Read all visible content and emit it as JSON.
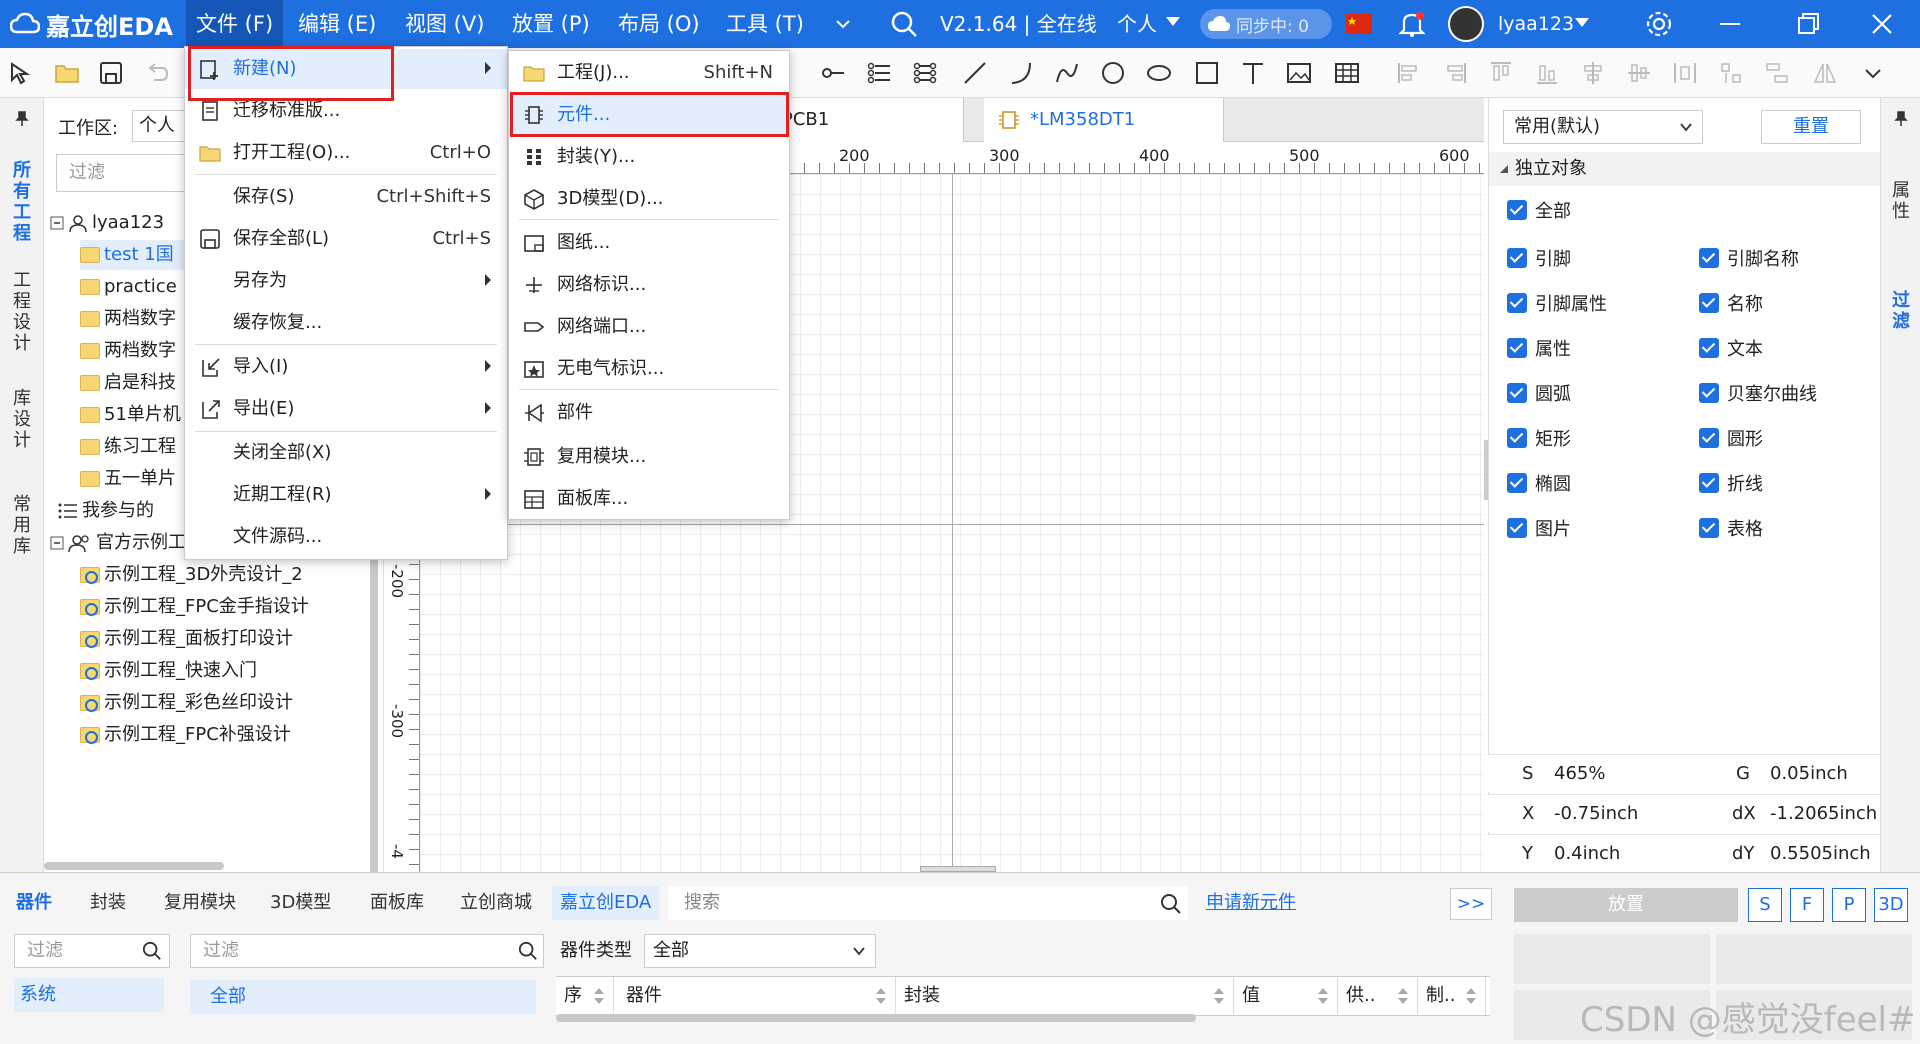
{
  "app": {
    "logo_text": "嘉立创EDA",
    "version_text": "V2.1.64 | 全在线",
    "mode_label": "个人",
    "sync_text": "同步中: 0",
    "user_name": "lyaa123"
  },
  "menubar": [
    {
      "label": "文件 (F)"
    },
    {
      "label": "编辑 (E)"
    },
    {
      "label": "视图 (V)"
    },
    {
      "label": "放置 (P)"
    },
    {
      "label": "布局 (O)"
    },
    {
      "label": "工具 (T)"
    }
  ],
  "workspace": {
    "label": "工作区:",
    "value": "个人",
    "filter_placeholder": "过滤"
  },
  "left_tabs": [
    "所有工程",
    "工程设计",
    "库设计",
    "常用库"
  ],
  "tree": {
    "user_root": "lyaa123",
    "projects": [
      "test 1国",
      "practice",
      "两档数字",
      "两档数字",
      "启是科技",
      "51单片机",
      "练习工程",
      "五一单片"
    ],
    "participated": "我参与的",
    "official_root": "官方示例工程",
    "examples": [
      "示例工程_3D外壳设计_2",
      "示例工程_FPC金手指设计",
      "示例工程_面板打印设计",
      "示例工程_快速入门",
      "示例工程_彩色丝印设计",
      "示例工程_FPC补强设计"
    ]
  },
  "doc_tabs": [
    "PCB1",
    "*LM358DT1"
  ],
  "ruler": {
    "h_ticks": [
      "200",
      "300",
      "400",
      "500",
      "600"
    ],
    "v_ticks": [
      "-200",
      "-300",
      "-4"
    ]
  },
  "file_menu": [
    {
      "label": "新建(N)",
      "shortcut": "",
      "submenu": true
    },
    {
      "label": "迁移标准版...",
      "shortcut": "",
      "submenu": false
    },
    {
      "label": "打开工程(O)...",
      "shortcut": "Ctrl+O",
      "submenu": false
    },
    {
      "label": "保存(S)",
      "shortcut": "Ctrl+Shift+S",
      "submenu": false
    },
    {
      "label": "保存全部(L)",
      "shortcut": "Ctrl+S",
      "submenu": false
    },
    {
      "label": "另存为",
      "shortcut": "",
      "submenu": true
    },
    {
      "label": "缓存恢复...",
      "shortcut": "",
      "submenu": false
    },
    {
      "label": "导入(I)",
      "shortcut": "",
      "submenu": true
    },
    {
      "label": "导出(E)",
      "shortcut": "",
      "submenu": true
    },
    {
      "label": "关闭全部(X)",
      "shortcut": "",
      "submenu": false
    },
    {
      "label": "近期工程(R)",
      "shortcut": "",
      "submenu": true
    },
    {
      "label": "文件源码...",
      "shortcut": "",
      "submenu": false
    }
  ],
  "new_submenu": [
    {
      "label": "工程(J)...",
      "shortcut": "Shift+N"
    },
    {
      "label": "元件...",
      "shortcut": ""
    },
    {
      "label": "封装(Y)...",
      "shortcut": ""
    },
    {
      "label": "3D模型(D)...",
      "shortcut": ""
    },
    {
      "label": "图纸...",
      "shortcut": ""
    },
    {
      "label": "网络标识...",
      "shortcut": ""
    },
    {
      "label": "网络端口...",
      "shortcut": ""
    },
    {
      "label": "无电气标识...",
      "shortcut": ""
    },
    {
      "label": "部件",
      "shortcut": ""
    },
    {
      "label": "复用模块...",
      "shortcut": ""
    },
    {
      "label": "面板库...",
      "shortcut": ""
    }
  ],
  "right_panel": {
    "preset_value": "常用(默认)",
    "reset_label": "重置",
    "section_label": "独立对象",
    "all_label": "全部",
    "filters_left": [
      "引脚",
      "引脚属性",
      "属性",
      "圆弧",
      "矩形",
      "椭圆",
      "图片"
    ],
    "filters_right": [
      "引脚名称",
      "名称",
      "文本",
      "贝塞尔曲线",
      "圆形",
      "折线",
      "表格"
    ],
    "strip_tabs": [
      "属性",
      "过滤"
    ]
  },
  "status": {
    "s_label": "S",
    "s_value": "465%",
    "g_label": "G",
    "g_value": "0.05inch",
    "x_label": "X",
    "x_value": "-0.75inch",
    "dx_label": "dX",
    "dx_value": "-1.2065inch",
    "y_label": "Y",
    "y_value": "0.4inch",
    "dy_label": "dY",
    "dy_value": "0.5505inch"
  },
  "bottom": {
    "tabs": [
      "器件",
      "封装",
      "复用模块",
      "3D模型",
      "面板库",
      "立创商城",
      "嘉立创EDA"
    ],
    "search_placeholder": "搜索",
    "apply_link": "申请新元件",
    "expand_label": ">>",
    "place_label": "放置",
    "type_buttons": [
      "S",
      "F",
      "P",
      "3D"
    ],
    "filter_placeholder": "过滤",
    "filter_placeholder2": "过滤",
    "category_system": "系统",
    "category_all": "全部",
    "type_label": "器件类型",
    "type_value": "全部",
    "columns": [
      "序",
      "器件",
      "封装",
      "值",
      "供..",
      "制.."
    ]
  },
  "watermark": "CSDN @感觉没feel#",
  "colors": {
    "accent": "#1e6fe0",
    "highlight_box": "#e02020"
  }
}
